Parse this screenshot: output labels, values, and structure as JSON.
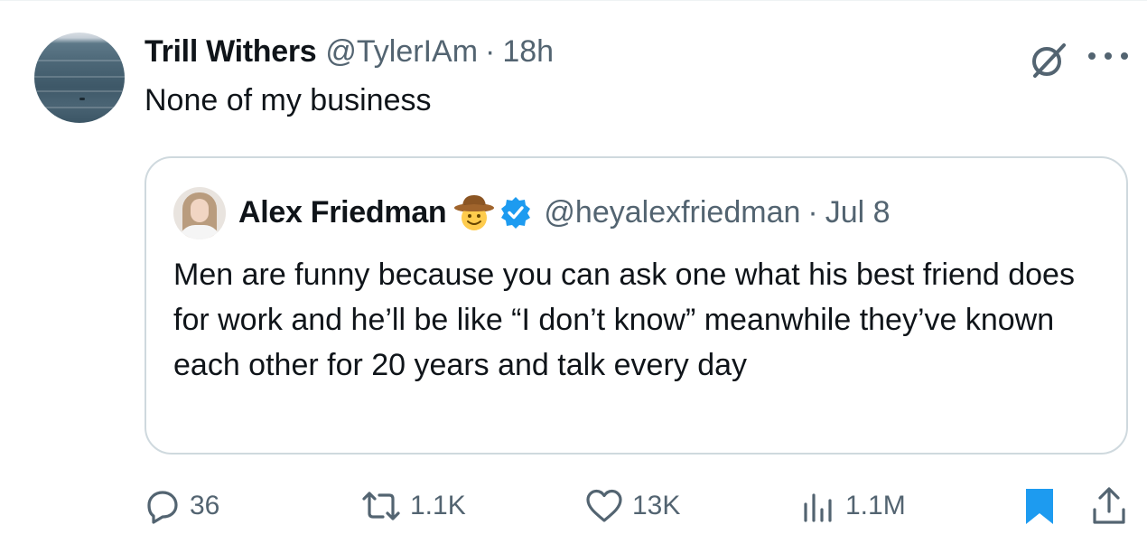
{
  "tweet": {
    "author": {
      "display_name": "Trill Withers",
      "handle": "@TylerIAm",
      "time": "18h"
    },
    "separator": "·",
    "text": "None of my business"
  },
  "quoted_tweet": {
    "author": {
      "display_name": "Alex Friedman",
      "emoji": "cowboy-face-emoji",
      "verified": true,
      "handle": "@heyalexfriedman",
      "time": "Jul 8"
    },
    "separator": "·",
    "text": "Men are funny because you can ask one what his best friend does for work and he’ll be like “I don’t know” meanwhile they’ve known each other for 20 years and talk every day"
  },
  "actions": {
    "replies": "36",
    "reposts": "1.1K",
    "likes": "13K",
    "views": "1.1M"
  },
  "colors": {
    "text_primary": "#0f1419",
    "text_secondary": "#536471",
    "border": "#cfd9de",
    "verified_blue": "#1d9bf0",
    "bookmark_blue": "#1d9bf0"
  }
}
